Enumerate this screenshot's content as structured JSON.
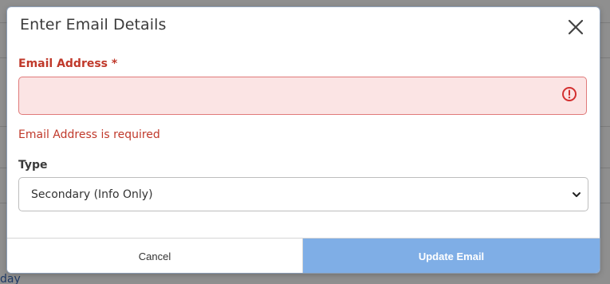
{
  "modal": {
    "title": "Enter Email Details",
    "email_label": "Email Address *",
    "email_value": "",
    "email_error": "Email Address is required",
    "type_label": "Type",
    "type_selected": "Secondary (Info Only)",
    "cancel_label": "Cancel",
    "update_label": "Update Email"
  },
  "background": {
    "partial_text": "day"
  },
  "colors": {
    "error": "#c0392b",
    "error_bg": "#fbe4e4",
    "primary_button": "#7faee6"
  },
  "icons": {
    "close": "close-icon",
    "alert": "alert-circle-icon",
    "chevron": "chevron-down-icon"
  }
}
